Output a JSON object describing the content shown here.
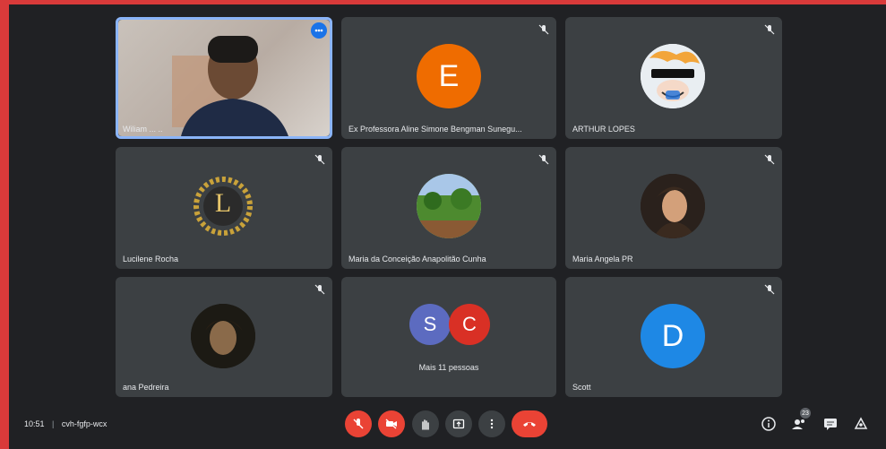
{
  "tiles": [
    {
      "name": "Wiliam ... ..",
      "type": "video"
    },
    {
      "name": "Ex Professora Aline Simone Bengman Sunegu...",
      "initial": "E",
      "color": "#ef6c00"
    },
    {
      "name": "ARTHUR LOPES",
      "type": "image-avatar"
    },
    {
      "name": "Lucilene Rocha",
      "type": "logo-avatar",
      "logo_letter": "L"
    },
    {
      "name": "Maria da Conceição Anapolitão Cunha",
      "type": "landscape-avatar"
    },
    {
      "name": "Maria Angela PR",
      "type": "photo-avatar"
    },
    {
      "name": "ana Pedreira",
      "type": "photo-avatar"
    },
    {
      "name": "",
      "type": "more",
      "initials": [
        "S",
        "C"
      ],
      "colors": [
        "#5c6bc0",
        "#d93025"
      ],
      "label": "Mais 11 pessoas"
    },
    {
      "name": "Scott",
      "initial": "D",
      "color": "#1e88e5"
    }
  ],
  "meeting": {
    "time": "10:51",
    "separator": "|",
    "code": "cvh-fgfp-wcx"
  },
  "participants_badge": "23",
  "colors": {
    "background": "#202124",
    "tile": "#3c4043",
    "danger": "#ea4335",
    "accent": "#8ab4f8"
  },
  "icons": [
    "mic-off-icon",
    "camera-off-icon",
    "raise-hand-icon",
    "present-icon",
    "more-options-icon",
    "end-call-icon",
    "info-icon",
    "people-icon",
    "chat-icon",
    "activities-icon"
  ]
}
